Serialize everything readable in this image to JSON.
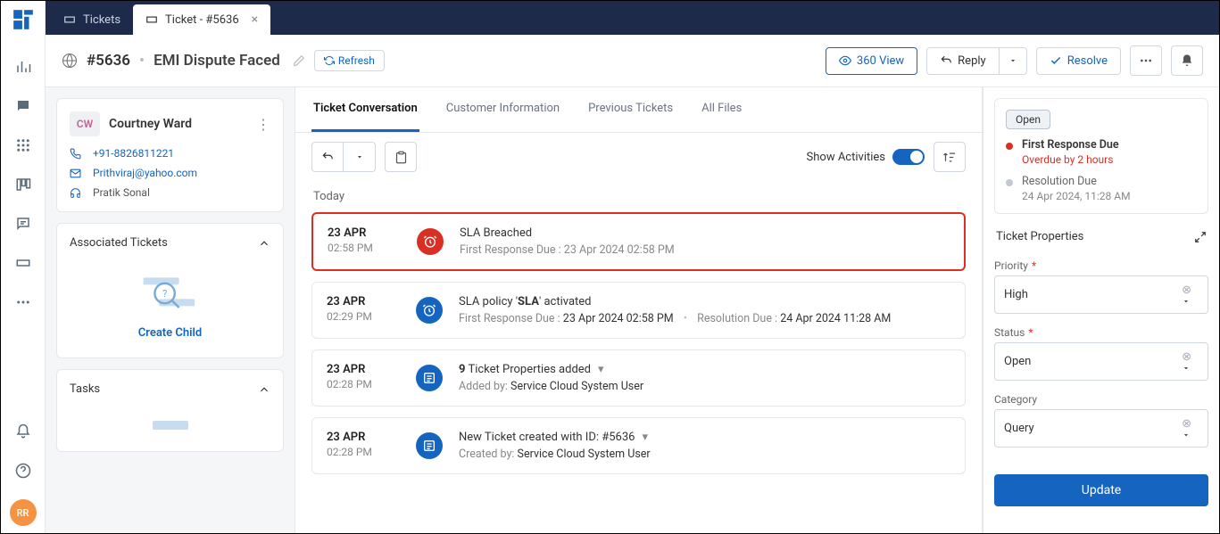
{
  "tabs": {
    "tickets": "Tickets",
    "current": "Ticket - #5636"
  },
  "header": {
    "ticket_id": "#5636",
    "title": "EMI Dispute Faced",
    "refresh": "Refresh",
    "view_360": "360 View",
    "reply": "Reply",
    "resolve": "Resolve"
  },
  "customer": {
    "initials": "CW",
    "name": "Courtney Ward",
    "phone": "+91-8826811221",
    "email": "Prithviraj@yahoo.com",
    "handle": "Pratik Sonal"
  },
  "left_sections": {
    "associated": "Associated Tickets",
    "create_child": "Create Child",
    "tasks": "Tasks"
  },
  "subtabs": {
    "conv": "Ticket Conversation",
    "cust": "Customer Information",
    "prev": "Previous Tickets",
    "files": "All Files"
  },
  "toolbar": {
    "show_activities": "Show Activities"
  },
  "timeline": {
    "today": "Today",
    "items": [
      {
        "date": "23 APR",
        "time": "02:58 PM",
        "title": "SLA Breached",
        "sub_label": "First Response Due : ",
        "sub_value": "23 Apr 2024 02:58 PM",
        "alert": true
      },
      {
        "date": "23 APR",
        "time": "02:29 PM",
        "title_pre": "SLA policy '",
        "title_bold": "SLA",
        "title_post": "' activated",
        "sub_label1": "First Response Due : ",
        "sub_value1": "23 Apr 2024 02:58 PM",
        "sub_label2": "Resolution Due : ",
        "sub_value2": "24 Apr 2024 11:28 AM"
      },
      {
        "date": "23 APR",
        "time": "02:28 PM",
        "title_bold": "9",
        "title_post": " Ticket Properties added",
        "sub_label": "Added by: ",
        "sub_value": "Service Cloud System User"
      },
      {
        "date": "23 APR",
        "time": "02:28 PM",
        "title_pre": "New Ticket created with ID: ",
        "title_link": "#5636",
        "sub_label": "Created by: ",
        "sub_value": "Service Cloud System User"
      }
    ]
  },
  "sla": {
    "open": "Open",
    "first_label": "First Response Due",
    "first_value": "Overdue by 2 hours",
    "res_label": "Resolution Due",
    "res_value": "24 Apr 2024, 11:28 AM"
  },
  "props": {
    "heading": "Ticket Properties",
    "priority_label": "Priority",
    "priority_value": "High",
    "status_label": "Status",
    "status_value": "Open",
    "category_label": "Category",
    "category_value": "Query",
    "update": "Update"
  },
  "avatar": "RR"
}
